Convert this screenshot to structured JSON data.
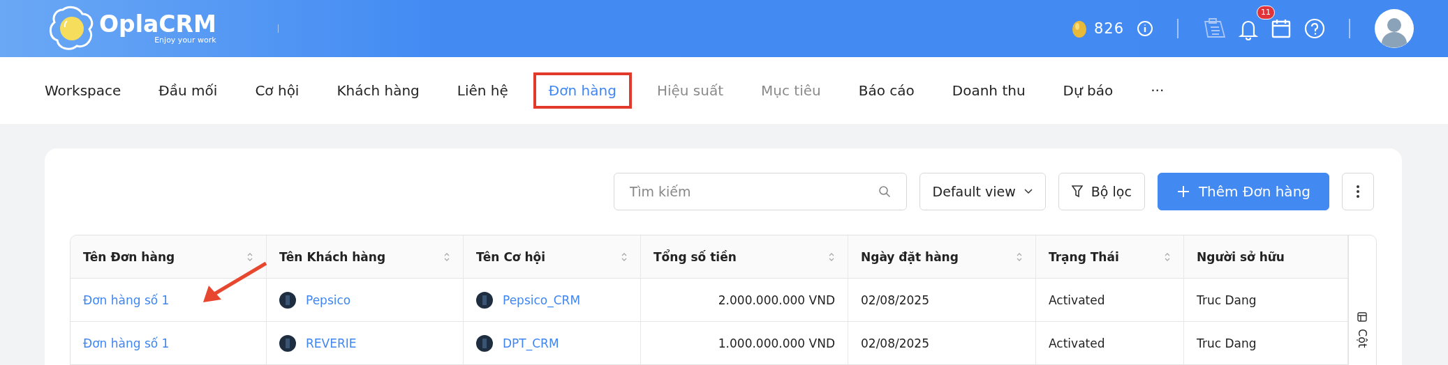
{
  "header": {
    "logo": {
      "name": "OplaCRM",
      "tagline": "Enjoy your work"
    },
    "coins": "826",
    "notification_count": "11"
  },
  "nav": {
    "items": [
      {
        "label": "Workspace",
        "selected": false,
        "disabled": false
      },
      {
        "label": "Đầu mối",
        "selected": false,
        "disabled": false
      },
      {
        "label": "Cơ hội",
        "selected": false,
        "disabled": false
      },
      {
        "label": "Khách hàng",
        "selected": false,
        "disabled": false
      },
      {
        "label": "Liên hệ",
        "selected": false,
        "disabled": false
      },
      {
        "label": "Đơn hàng",
        "selected": true,
        "disabled": false
      },
      {
        "label": "Hiệu suất",
        "selected": false,
        "disabled": true
      },
      {
        "label": "Mục tiêu",
        "selected": false,
        "disabled": true
      },
      {
        "label": "Báo cáo",
        "selected": false,
        "disabled": false
      },
      {
        "label": "Doanh thu",
        "selected": false,
        "disabled": false
      },
      {
        "label": "Dự báo",
        "selected": false,
        "disabled": false
      }
    ],
    "more": "···"
  },
  "toolbar": {
    "search": {
      "placeholder": "Tìm kiếm"
    },
    "view": "Default view",
    "filter": "Bộ lọc",
    "add": "Thêm Đơn hàng"
  },
  "table": {
    "columns": [
      {
        "label": "Tên Đơn hàng",
        "sortable": true
      },
      {
        "label": "Tên Khách hàng",
        "sortable": true
      },
      {
        "label": "Tên Cơ hội",
        "sortable": true
      },
      {
        "label": "Tổng số tiền",
        "sortable": true
      },
      {
        "label": "Ngày đặt hàng",
        "sortable": true
      },
      {
        "label": "Trạng Thái",
        "sortable": true
      },
      {
        "label": "Người sở hữu",
        "sortable": false
      }
    ],
    "rows": [
      {
        "order": "Đơn hàng số 1",
        "customer": "Pepsico",
        "opportunity": "Pepsico_CRM",
        "amount": "2.000.000.000 VND",
        "date": "02/08/2025",
        "status": "Activated",
        "owner": "Truc Dang"
      },
      {
        "order": "Đơn hàng số 1",
        "customer": "REVERIE",
        "opportunity": "DPT_CRM",
        "amount": "1.000.000.000 VND",
        "date": "02/08/2025",
        "status": "Activated",
        "owner": "Truc Dang"
      }
    ],
    "side_label": "Cột"
  }
}
